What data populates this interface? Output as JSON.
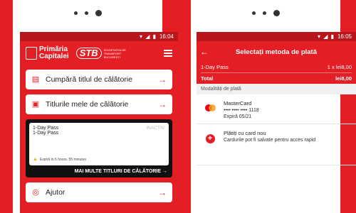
{
  "left": {
    "status_time": "16:04",
    "brand": {
      "name_line1": "Primăria",
      "name_line2": "Capitalei",
      "stb": "STB",
      "stb_sub": "SOCIETATEA DE TRANSPORT BUCUREȘTI"
    },
    "cards": [
      {
        "label": "Cumpără titlul de călătorie"
      },
      {
        "label": "Titlurile mele de călătorie"
      }
    ],
    "pass": {
      "line1": "1-Day Pass",
      "line2": "1-Day Pass",
      "status": "INACTIV",
      "warning": "Expiră în 5 hours, 55 minutes",
      "more": "MAI MULTE TITLURI DE CĂLĂTORIE"
    },
    "help": {
      "label": "Ajutor"
    }
  },
  "right": {
    "status_time": "16:05",
    "title": "Selectați metoda de plată",
    "item_label": "1-Day Pass",
    "item_value": "1 x lei8,00",
    "total_label": "Total",
    "total_value": "lei8,00",
    "section_header": "Modalități de plată",
    "methods": [
      {
        "name": "MasterCard",
        "number": "•••• •••• •••• 1118",
        "expiry": "Expiră 05/21"
      },
      {
        "name": "Plătiți cu card nou",
        "desc": "Cardurile pot fi salvate pentru acces rapid"
      }
    ]
  },
  "colors": {
    "accent": "#e31e24"
  }
}
